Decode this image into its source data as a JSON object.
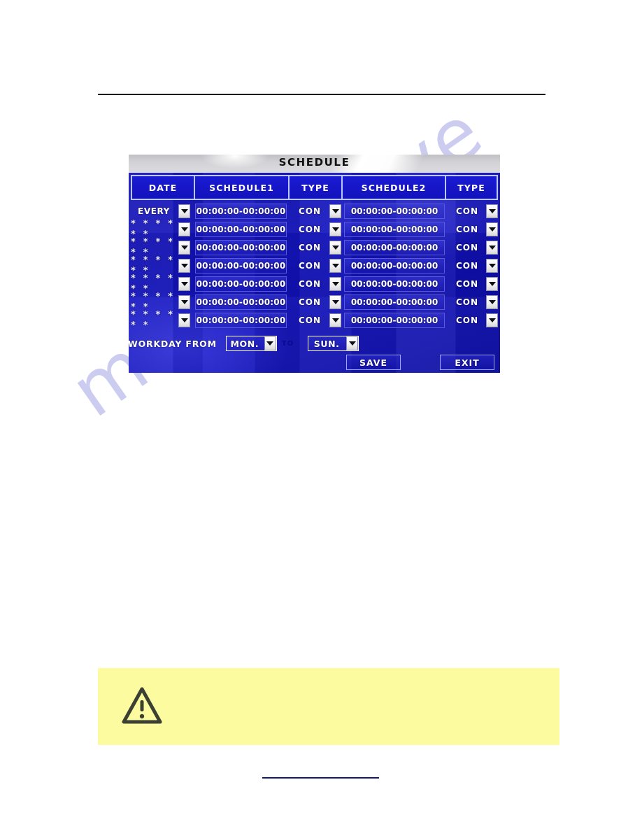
{
  "watermark": {
    "text": "manualshive"
  },
  "panel": {
    "title": "SCHEDULE",
    "headers": [
      "DATE",
      "SCHEDULE1",
      "TYPE",
      "SCHEDULE2",
      "TYPE"
    ],
    "rows": [
      {
        "date": "EVERY",
        "schedule1": "00:00:00-00:00:00",
        "type1": "CON",
        "schedule2": "00:00:00-00:00:00",
        "type2": "CON"
      },
      {
        "date": "* * * * * *",
        "schedule1": "00:00:00-00:00:00",
        "type1": "CON",
        "schedule2": "00:00:00-00:00:00",
        "type2": "CON"
      },
      {
        "date": "* * * * * *",
        "schedule1": "00:00:00-00:00:00",
        "type1": "CON",
        "schedule2": "00:00:00-00:00:00",
        "type2": "CON"
      },
      {
        "date": "* * * * * *",
        "schedule1": "00:00:00-00:00:00",
        "type1": "CON",
        "schedule2": "00:00:00-00:00:00",
        "type2": "CON"
      },
      {
        "date": "* * * * * *",
        "schedule1": "00:00:00-00:00:00",
        "type1": "CON",
        "schedule2": "00:00:00-00:00:00",
        "type2": "CON"
      },
      {
        "date": "* * * * * *",
        "schedule1": "00:00:00-00:00:00",
        "type1": "CON",
        "schedule2": "00:00:00-00:00:00",
        "type2": "CON"
      },
      {
        "date": "* * * * * *",
        "schedule1": "00:00:00-00:00:00",
        "type1": "CON",
        "schedule2": "00:00:00-00:00:00",
        "type2": "CON"
      }
    ],
    "footer": {
      "workday_label": "WORKDAY FROM",
      "from_day": "MON.",
      "to_label": "TO",
      "to_day": "SUN.",
      "save_label": "SAVE",
      "exit_label": "EXIT"
    }
  },
  "note": {
    "icon": "warning-triangle-icon",
    "text": ""
  },
  "colors": {
    "screen_blue": "#1212bc",
    "header_border": "#b9c6ff",
    "note_yellow": "#fcfba0",
    "link_blue": "#16186e",
    "watermark": "#ccccf0"
  }
}
